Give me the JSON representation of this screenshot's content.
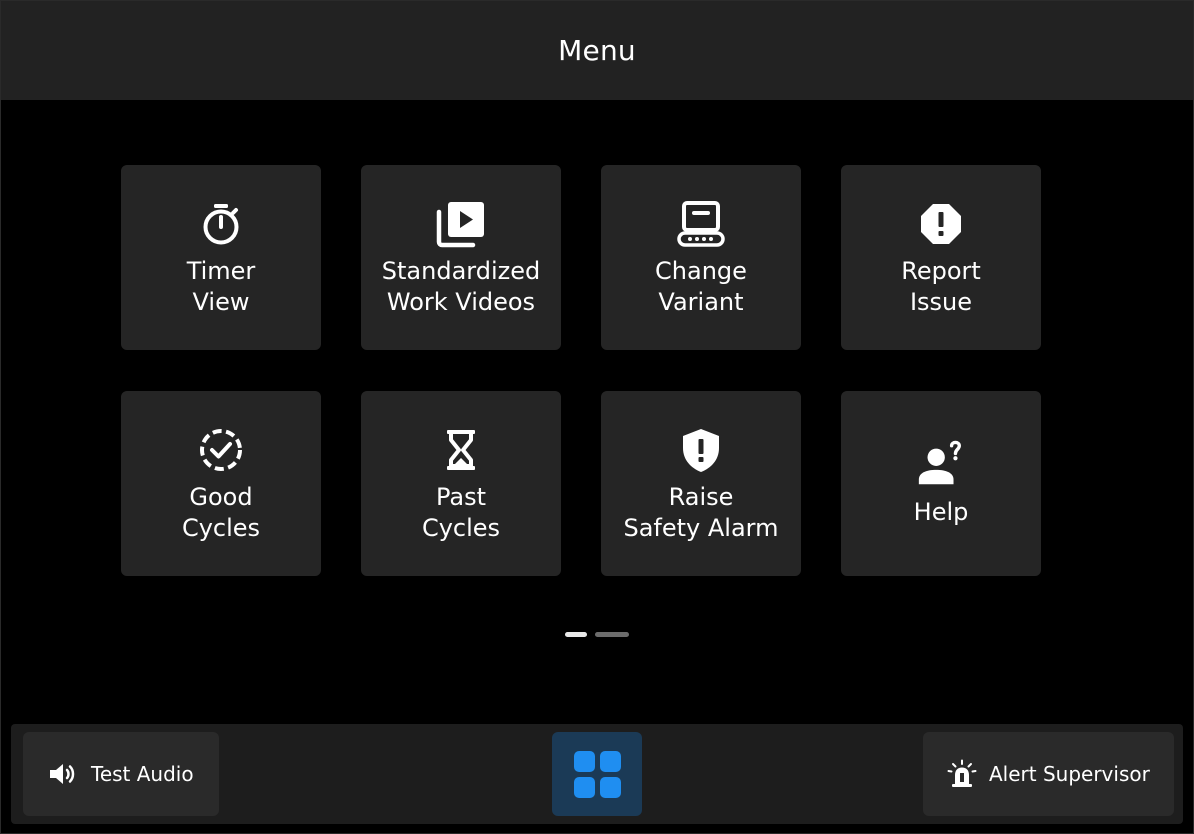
{
  "header": {
    "title": "Menu"
  },
  "tiles": [
    {
      "label": "Timer\nView",
      "icon": "stopwatch-icon"
    },
    {
      "label": "Standardized\nWork Videos",
      "icon": "video-library-icon"
    },
    {
      "label": "Change\nVariant",
      "icon": "conveyor-icon"
    },
    {
      "label": "Report\nIssue",
      "icon": "report-octagon-icon"
    },
    {
      "label": "Good\nCycles",
      "icon": "dashed-check-circle-icon"
    },
    {
      "label": "Past\nCycles",
      "icon": "hourglass-icon"
    },
    {
      "label": "Raise\nSafety Alarm",
      "icon": "shield-alert-icon"
    },
    {
      "label": "Help",
      "icon": "person-question-icon"
    }
  ],
  "pager": {
    "current_page": 1,
    "total_pages": 2
  },
  "bottom_bar": {
    "test_audio_label": "Test Audio",
    "alert_supervisor_label": "Alert Supervisor"
  },
  "colors": {
    "accent": "#1f8ef1",
    "apps_button_bg": "#1b3a56",
    "tile_bg": "#252525",
    "header_bg": "#222222"
  }
}
